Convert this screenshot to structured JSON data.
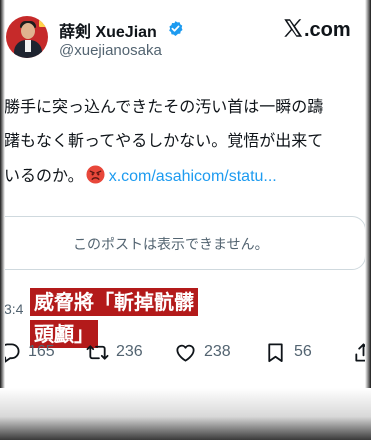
{
  "header": {
    "display_name": "薛剣 XueJian",
    "handle": "@xuejianosaka",
    "site_label": ".com"
  },
  "tweet": {
    "lines": [
      "勝手に突っ込んできたその汚い首は一瞬の躊",
      "躇もなく斬ってやるしかない。覚悟が出来て",
      "いるのか。"
    ],
    "link_text": "x.com/asahicom/statu..."
  },
  "quote": {
    "unavailable_text": "このポストは表示できません。"
  },
  "timestamp": "3:4",
  "caption": {
    "line1": "威脅將「斬掉骯髒",
    "line2": "頭顱」"
  },
  "actions": {
    "reply_count": "165",
    "retweet_count": "236",
    "like_count": "238",
    "bookmark_count": "56"
  },
  "colors": {
    "verified_badge": "#1d9bf0",
    "link": "#1d9bf0",
    "caption_bg": "#b31a1a",
    "muted_text": "#536471"
  },
  "icons": [
    "verified-badge-icon",
    "x-logo-icon",
    "angry-face-emoji",
    "reply-icon",
    "retweet-icon",
    "like-icon",
    "bookmark-icon",
    "share-icon"
  ]
}
